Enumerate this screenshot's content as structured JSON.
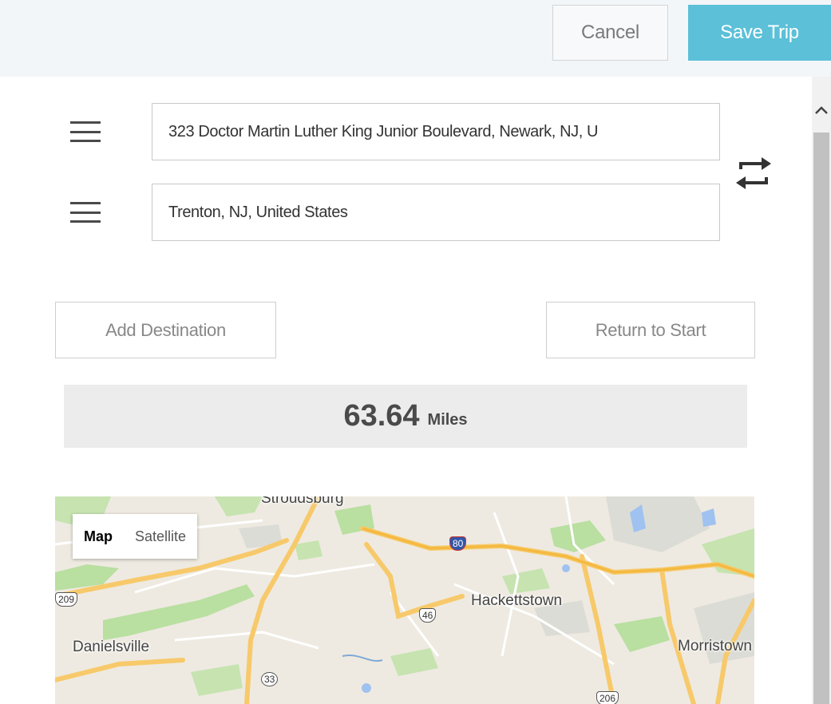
{
  "header": {
    "cancel_label": "Cancel",
    "save_label": "Save Trip"
  },
  "route": {
    "start_value": "323 Doctor Martin Luther King Junior Boulevard, Newark, NJ, U",
    "end_value": "Trenton, NJ, United States"
  },
  "actions": {
    "add_destination_label": "Add Destination",
    "return_to_start_label": "Return to Start"
  },
  "summary": {
    "distance_value": "63.64",
    "distance_unit": "Miles"
  },
  "map": {
    "map_type_map": "Map",
    "map_type_satellite": "Satellite",
    "places": {
      "stroudsburg": "Stroudsburg",
      "hackettstown": "Hackettstown",
      "danielsville": "Danielsville",
      "morristown": "Morristown"
    },
    "shields": {
      "i80": "80",
      "us209": "209",
      "us46": "46",
      "r33": "33",
      "us206": "206"
    }
  },
  "colors": {
    "accent": "#5bc0d8",
    "topbar_bg": "#f3f6f9",
    "summary_bg": "#ececec",
    "map_land": "#eeeae1",
    "map_green": "#b9dfa1",
    "map_road": "#f7c96a"
  },
  "icons": {
    "drag_handle": "hamburger-icon",
    "swap": "swap-arrows-icon",
    "scroll_up": "chevron-up-icon"
  }
}
